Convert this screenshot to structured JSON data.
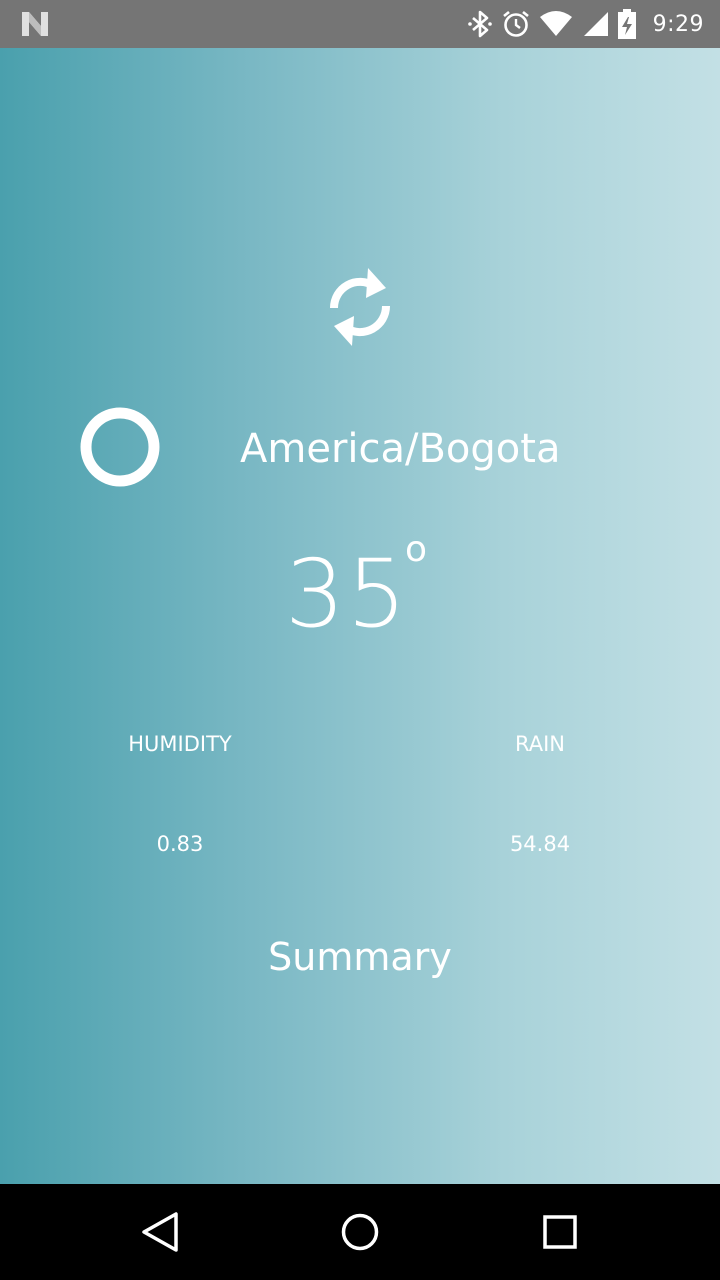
{
  "status_bar": {
    "time": "9:29",
    "icons": [
      "n-logo-icon",
      "bluetooth-icon",
      "alarm-icon",
      "wifi-icon",
      "signal-icon",
      "battery-charging-icon"
    ]
  },
  "weather": {
    "refresh_icon": "refresh-icon",
    "condition_icon": "ring-icon",
    "city": "America/Bogota",
    "temperature": "35",
    "degree_symbol": "o",
    "humidity_label": "HUMIDITY",
    "humidity_value": "0.83",
    "rain_label": "RAIN",
    "rain_value": "54.84",
    "summary": "Summary"
  },
  "nav_bar": {
    "icons": [
      "back-icon",
      "home-icon",
      "recents-icon"
    ]
  },
  "colors": {
    "status_bar": "#757575",
    "gradient_start": "#4aa0ad",
    "gradient_end": "#c3e0e5",
    "text": "#ffffff",
    "nav_bar": "#000000"
  }
}
